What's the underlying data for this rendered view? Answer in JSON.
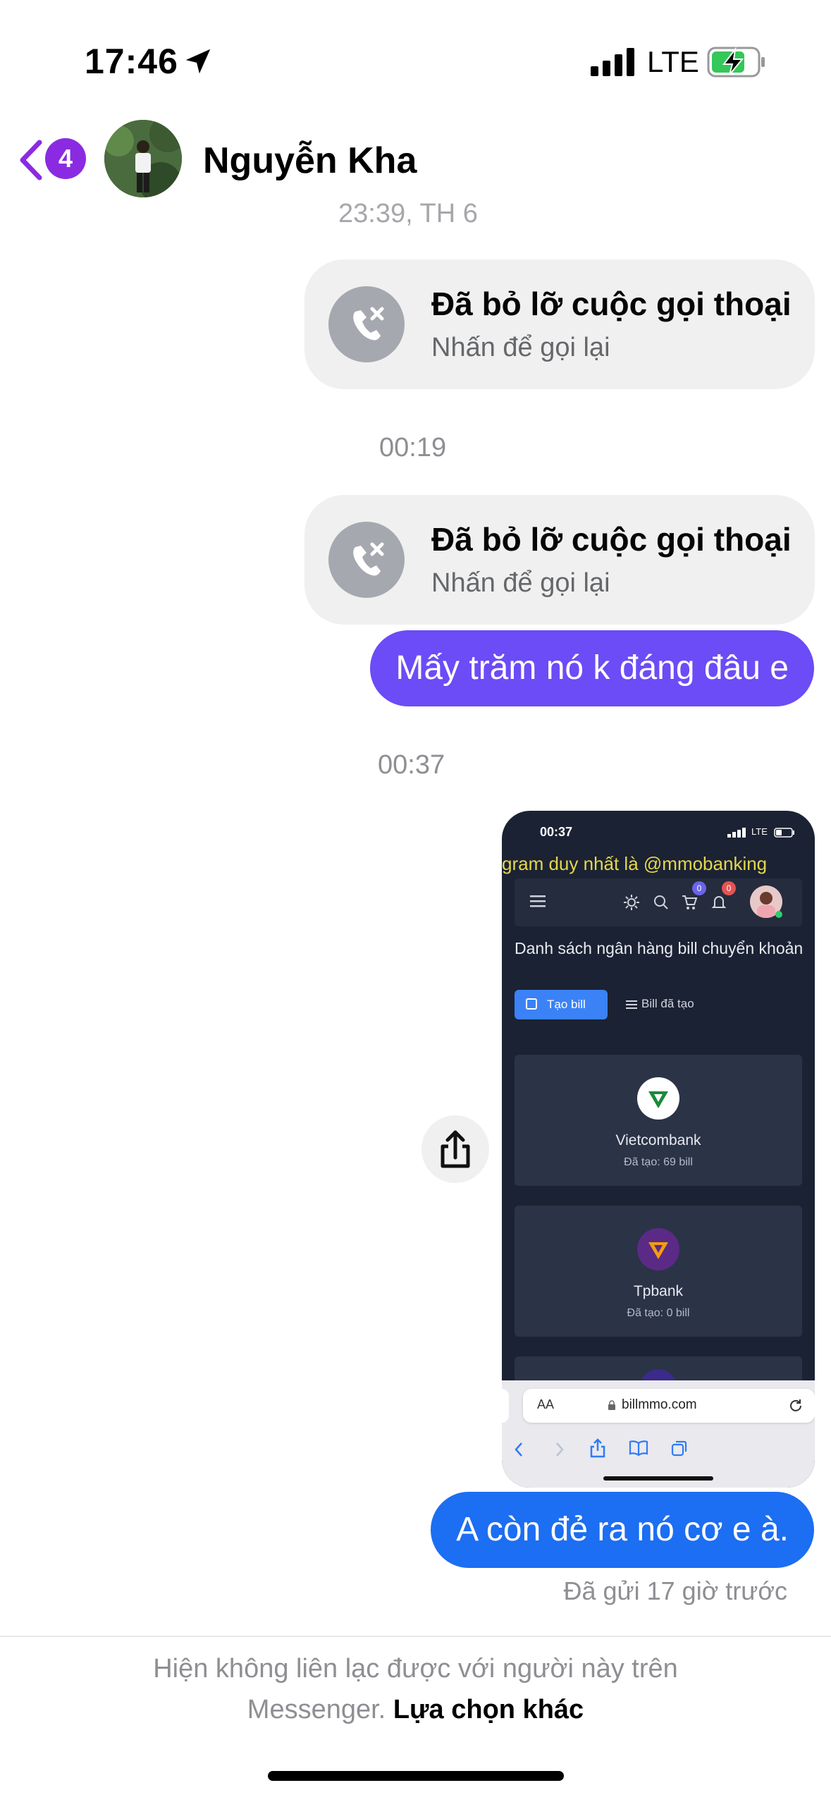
{
  "status_bar": {
    "time": "17:46",
    "network": "LTE",
    "battery_charging": true
  },
  "header": {
    "badge_count": "4",
    "contact_name": "Nguyễn Kha"
  },
  "messages": {
    "ts1": "23:39, TH 6",
    "call1": {
      "title": "Đã bỏ lỡ cuộc gọi thoại",
      "subtitle": "Nhấn để gọi lại"
    },
    "ts2": "00:19",
    "call2": {
      "title": "Đã bỏ lỡ cuộc gọi thoại",
      "subtitle": "Nhấn để gọi lại"
    },
    "msg1": "Mấy trăm nó k đáng đâu e",
    "ts3": "00:37",
    "msg2": "A còn đẻ ra nó cơ e à.",
    "sent_status": "Đã gửi 17 giờ trước"
  },
  "screenshot": {
    "time": "00:37",
    "network": "LTE",
    "marquee": "gram duy nhất là @mmobanking",
    "cart_badge": "0",
    "bell_badge": "0",
    "heading": "Danh sách ngân hàng bill chuyển khoản",
    "create_btn": "Tạo bill",
    "created_tab": "Bill đã tạo",
    "banks": [
      {
        "name": "Vietcombank",
        "count": "Đã tạo: 69 bill"
      },
      {
        "name": "Tpbank",
        "count": "Đã tạo: 0 bill"
      }
    ],
    "browser_aa": "AA",
    "url": "billmmo.com"
  },
  "footer": {
    "line1": "Hiện không liên lạc được với người này trên",
    "line2_muted": "Messenger.",
    "line2_link": "Lựa chọn khác"
  },
  "colors": {
    "accent_purple": "#6b4cf6",
    "accent_blue": "#1c6ef2",
    "back_purple": "#8a2be2"
  }
}
